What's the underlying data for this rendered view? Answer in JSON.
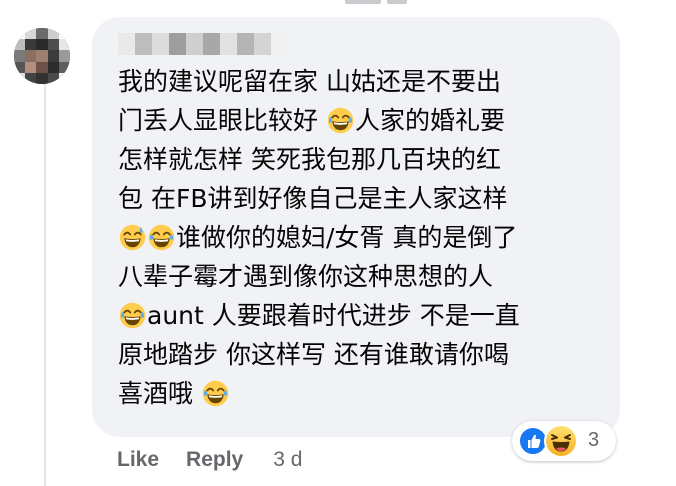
{
  "comment": {
    "lines": [
      [
        "我的建议呢留在家 山姑还是不要出"
      ],
      [
        "门丢人显眼比较好 ",
        "@laugh",
        "人家的婚礼要"
      ],
      [
        "怎样就怎样 笑死我包那几百块的红"
      ],
      [
        "包 在FB讲到好像自己是主人家这样"
      ],
      [
        "@sweat",
        "@laugh",
        "谁做你的媳妇/女胥 真的是倒了"
      ],
      [
        "八辈子霉才遇到像你这种思想的人"
      ],
      [
        "@laugh",
        "aunt 人要跟着时代进步 不是一直"
      ],
      [
        "原地踏步 你这样写 还有谁敢请你喝"
      ],
      [
        "喜酒哦 ",
        "@laugh"
      ]
    ]
  },
  "reactions": {
    "count": "3",
    "types": [
      "like-icon",
      "haha-icon"
    ]
  },
  "actions": {
    "like_label": "Like",
    "reply_label": "Reply",
    "timestamp": "3 d"
  },
  "colors": {
    "bubble": "#f0f2f5",
    "text": "#050505",
    "meta": "#65676b",
    "like_blue": "#1877f2",
    "emoji_yellow": "#ffcc4d"
  }
}
